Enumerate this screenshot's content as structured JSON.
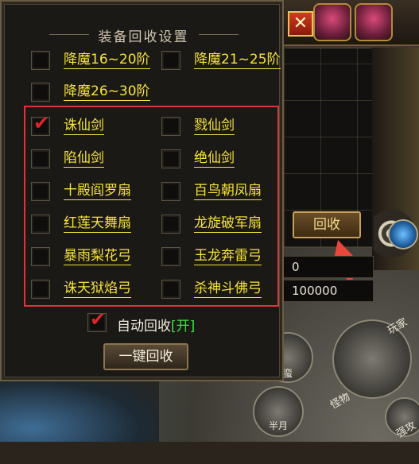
{
  "dialog": {
    "title": "装备回收设置",
    "close_label": "✕",
    "items": [
      {
        "label": "降魔16~20阶",
        "checked": false
      },
      {
        "label": "降魔21~25阶",
        "checked": false
      },
      {
        "label": "降魔26~30阶",
        "checked": false
      },
      {
        "label": "诛仙剑",
        "checked": true
      },
      {
        "label": "戮仙剑",
        "checked": false
      },
      {
        "label": "陷仙剑",
        "checked": false
      },
      {
        "label": "绝仙剑",
        "checked": false
      },
      {
        "label": "十殿阎罗扇",
        "checked": false
      },
      {
        "label": "百鸟朝凤扇",
        "checked": false
      },
      {
        "label": "红莲天舞扇",
        "checked": false
      },
      {
        "label": "龙旋破军扇",
        "checked": false
      },
      {
        "label": "暴雨梨花弓",
        "checked": false
      },
      {
        "label": "玉龙奔雷弓",
        "checked": false
      },
      {
        "label": "诛天狱焰弓",
        "checked": false
      },
      {
        "label": "杀神斗佛弓",
        "checked": false
      }
    ],
    "auto_recycle": {
      "label": "自动回收",
      "state": "[开]",
      "checked": true
    },
    "one_key_button": "一键回收"
  },
  "side_panel": {
    "recycle_button": "回收",
    "value_1": "0",
    "value_2": "100000"
  },
  "hud": {
    "skill_labels": [
      "蛮",
      "半月",
      "怪物",
      "玩家",
      "强攻"
    ]
  },
  "colors": {
    "label": "#f5e33a",
    "highlight_box": "#e0333a",
    "check": "#e0252a",
    "auto_state": "#3fe04a"
  }
}
